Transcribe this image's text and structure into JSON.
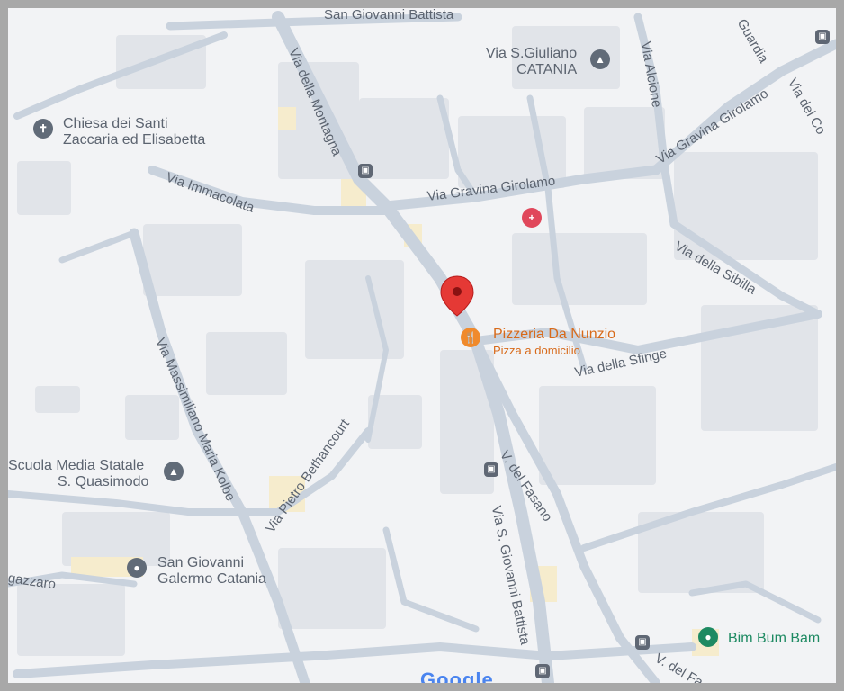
{
  "map": {
    "roads": [
      {
        "name": "San Giovanni Battista",
        "label": "San Giovanni Battista"
      },
      {
        "name": "Via della Montagna",
        "label": "Via della Montagna"
      },
      {
        "name": "Via Alcione",
        "label": "Via Alcione"
      },
      {
        "name": "Via Gravina Girolamo north",
        "label": "Via Gravina Girolamo"
      },
      {
        "name": "Via Gravina Girolamo",
        "label": "Via Gravina Girolamo"
      },
      {
        "name": "Via Immacolata",
        "label": "Via Immacolata"
      },
      {
        "name": "Via della Sibilla",
        "label": "Via della Sibilla"
      },
      {
        "name": "Via della Sfinge",
        "label": "Via della Sfinge"
      },
      {
        "name": "Via Massimiliano Maria Kolbe",
        "label": "Via Massimiliano Maria Kolbe"
      },
      {
        "name": "Via Pietro Bethancourt",
        "label": "Via Pietro Bethancourt"
      },
      {
        "name": "V. del Fasano",
        "label": "V. del Fasano"
      },
      {
        "name": "Via S. Giovanni Battista",
        "label": "Via S. Giovanni Battista"
      },
      {
        "name": "Guardia",
        "label": "Guardia"
      },
      {
        "name": "Via del Co",
        "label": "Via del Co"
      },
      {
        "name": "gazzaro",
        "label": "gazzaro"
      },
      {
        "name": "V. del Fa",
        "label": "V. del Fa"
      }
    ],
    "pois": {
      "chiesa": {
        "line1": "Chiesa dei Santi",
        "line2": "Zaccaria ed Elisabetta",
        "icon": "cross-icon"
      },
      "sgiuliano": {
        "line1": "Via S.Giuliano",
        "line2": "CATANIA",
        "icon": "school-icon"
      },
      "pizzeria": {
        "line1": "Pizzeria Da Nunzio",
        "line2": "Pizza a domicilio",
        "icon": "restaurant-icon"
      },
      "scuola": {
        "line1": "Scuola Media Statale",
        "line2": "S. Quasimodo",
        "icon": "school-icon"
      },
      "sangiovanni": {
        "line1": "San Giovanni",
        "line2": "Galermo Catania",
        "icon": "place-icon"
      },
      "bimbum": {
        "line1": "Bim Bum Bam",
        "icon": "place-icon"
      }
    },
    "google_logo": "Google",
    "colors": {
      "background": "#f2f3f5",
      "road": "#c9d2dd",
      "block": "#dfe3e8",
      "pin": "#e53935",
      "orange": "#f08a2c",
      "green": "#1e8a62"
    }
  }
}
